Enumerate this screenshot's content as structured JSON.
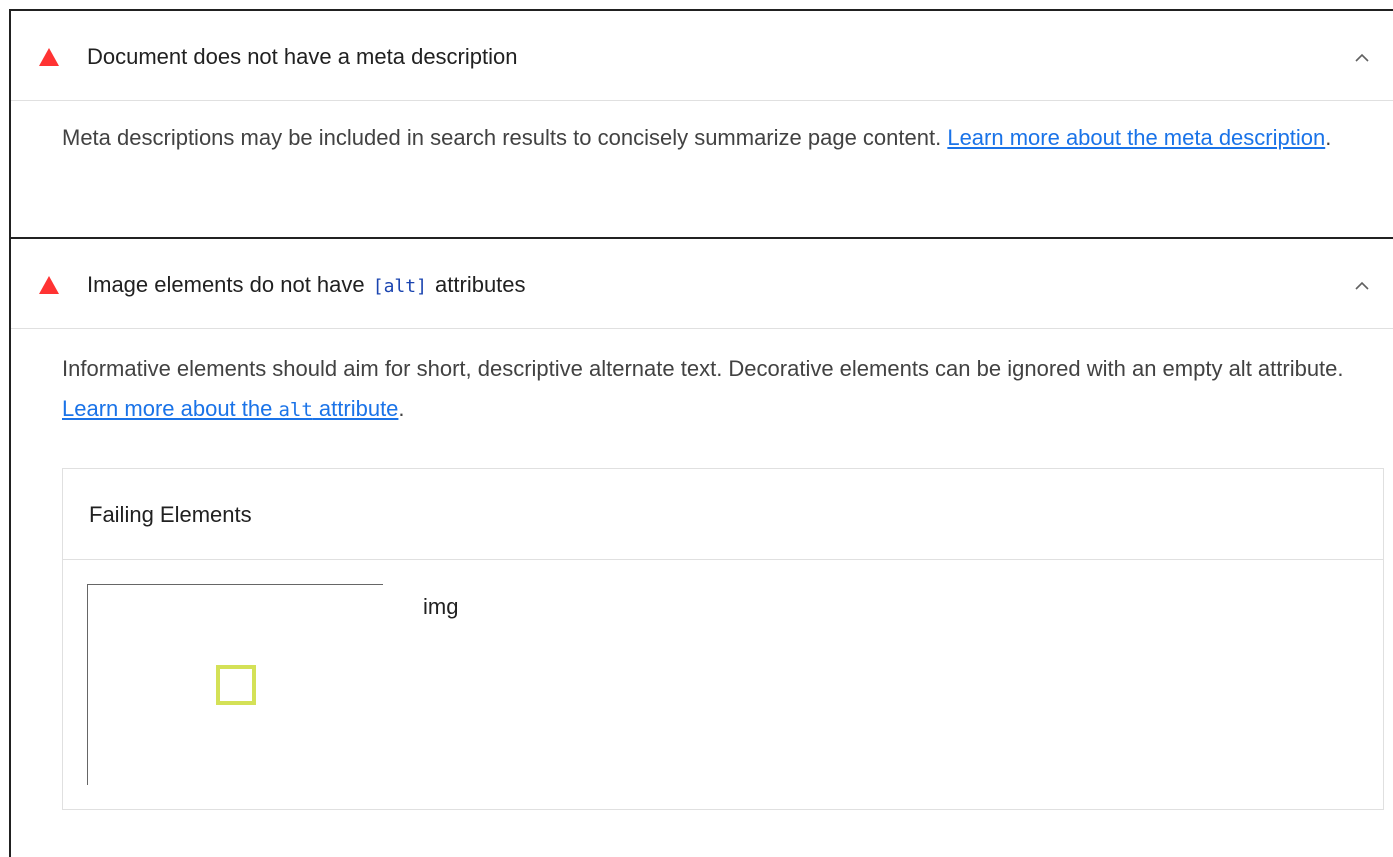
{
  "audits": [
    {
      "title": "Document does not have a meta description",
      "description": "Meta descriptions may be included in search results to concisely summarize page content. ",
      "link_text": "Learn more about the meta description",
      "trailing": "."
    },
    {
      "title_before": "Image elements do not have ",
      "title_code": "[alt]",
      "title_after": " attributes",
      "description": "Informative elements should aim for short, descriptive alternate text. Decorative elements can be ignored with an empty alt attribute. ",
      "link_before": "Learn more about the ",
      "link_code": "alt",
      "link_after": " attribute",
      "trailing": ".",
      "table": {
        "header": "Failing Elements",
        "rows": [
          {
            "node": "img"
          }
        ]
      }
    }
  ],
  "colors": {
    "warning": "#ff3333",
    "link": "#1a73e8",
    "code": "#1a44b0",
    "highlight": "#d4e157"
  }
}
